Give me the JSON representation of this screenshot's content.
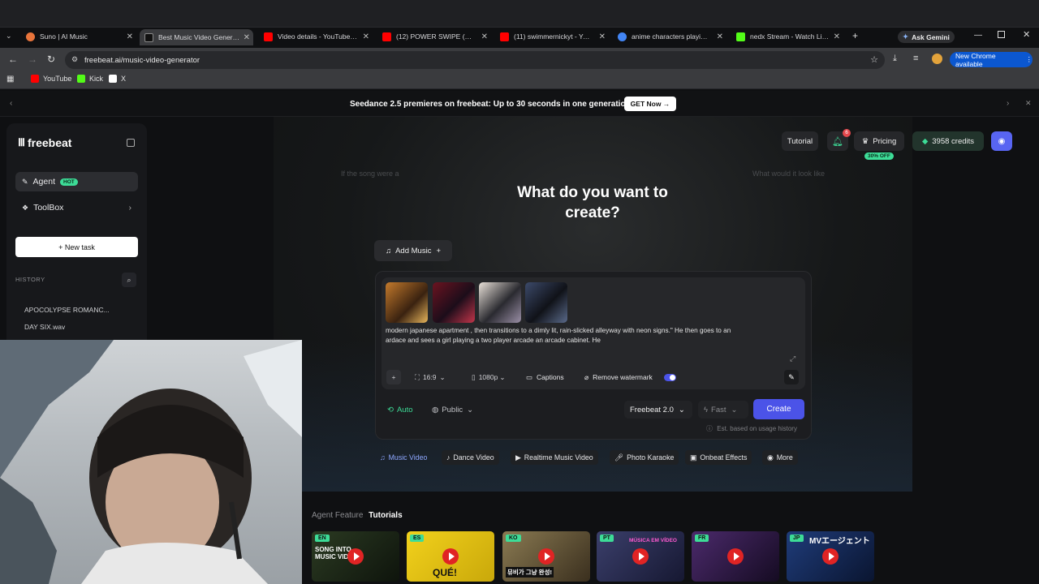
{
  "browser": {
    "tabs": [
      {
        "title": "Suno | AI Music",
        "color": "#e8743b"
      },
      {
        "title": "Best Music Video Generator",
        "color": "#ffffff"
      },
      {
        "title": "Video details - YouTube Stu",
        "color": "#ff0000"
      },
      {
        "title": "(12) POWER SWIPE (VERS...",
        "color": "#ff0000"
      },
      {
        "title": "(11) swimmernickyt - YouTu",
        "color": "#ff0000"
      },
      {
        "title": "anime characters playing ar",
        "color": "#4285f4"
      },
      {
        "title": "nedx Stream - Watch Live o",
        "color": "#53fc18"
      }
    ],
    "ask_gemini": "Ask Gemini",
    "url": "freebeat.ai/music-video-generator",
    "new_chrome": "New Chrome available",
    "bookmarks": [
      {
        "label": "YouTube",
        "color": "#ff0000"
      },
      {
        "label": "Kick",
        "color": "#53fc18"
      },
      {
        "label": "X",
        "color": "#ffffff"
      }
    ]
  },
  "banner": {
    "text": "Seedance 2.5 premieres on freebeat: Up to 30 seconds in one generation.",
    "button": "GET Now →"
  },
  "sidebar": {
    "logo": "freebeat",
    "agent": "Agent",
    "hot": "HOT",
    "toolbox": "ToolBox",
    "new_task": "+ New task",
    "history_label": "HISTORY",
    "history": [
      "APOCOLYPSE ROMANC...",
      "DAY SIX.wav"
    ]
  },
  "header": {
    "tutorial": "Tutorial",
    "notif_count": "6",
    "pricing": "Pricing",
    "discount": "30% OFF",
    "credits": "3958 credits"
  },
  "hero": {
    "left_hint": "If the song were a",
    "right_hint": "What would it look like",
    "title_line1": "What do you want to",
    "title_line2": "create?"
  },
  "composer": {
    "add_music": "Add Music",
    "prompt_line1": "modern japanese apartment , then transitions to a dimly lit, rain-slicked alleyway with neon signs.\" He then goes to an",
    "prompt_line2": "ardace and sees a girl playing a two player arcade an arcade cabinet.  He",
    "ratio": "16:9",
    "resolution": "1080p",
    "captions": "Captions",
    "remove_watermark": "Remove watermark",
    "auto": "Auto",
    "visibility": "Public",
    "model": "Freebeat 2.0",
    "speed": "Fast",
    "create": "Create",
    "estimate": "Est. based on usage history"
  },
  "categories": [
    "Music Video",
    "Dance Video",
    "Realtime Music Video",
    "Photo Karaoke",
    "Onbeat Effects",
    "More"
  ],
  "tutorials": {
    "prefix": "Agent Feature",
    "title": "Tutorials",
    "videos": [
      {
        "lang": "EN",
        "caption": "SONG INTO MUSIC VID",
        "color": "#2b3a22"
      },
      {
        "lang": "ES",
        "caption": "QUÉ!",
        "color": "#f2d11c"
      },
      {
        "lang": "KO",
        "caption": "뮤비가 그냥 완성!",
        "color": "#6b5a3a"
      },
      {
        "lang": "PT",
        "caption": "MÚSICA EM VÍDEO",
        "color": "#3b3f6b"
      },
      {
        "lang": "FR",
        "caption": "",
        "color": "#4b2a6b"
      },
      {
        "lang": "JP",
        "caption": "MVエージェント",
        "color": "#1f3c7a"
      }
    ]
  }
}
